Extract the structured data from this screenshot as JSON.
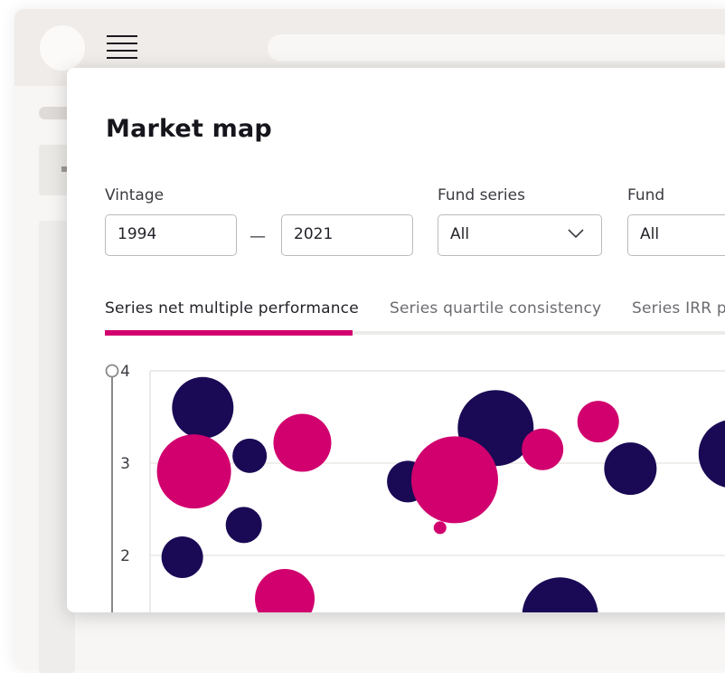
{
  "modal": {
    "title": "Market map",
    "filters": {
      "vintage_label": "Vintage",
      "vintage_from": "1994",
      "vintage_separator": "—",
      "vintage_to": "2021",
      "fund_series_label": "Fund series",
      "fund_series_value": "All",
      "fund_label": "Fund",
      "fund_value": "All"
    },
    "tabs": [
      {
        "label": "Series net multiple performance",
        "active": true
      },
      {
        "label": "Series quartile consistency",
        "active": false
      },
      {
        "label": "Series IRR pe",
        "active": false
      }
    ]
  },
  "colors": {
    "accent": "#d1006e",
    "navy": "#1a0a55",
    "tab_rule": "#ecebe9"
  },
  "icons": {
    "menu": "hamburger-menu-icon",
    "dropdown": "chevron-down-icon",
    "slider_handle": "circle-handle-icon"
  },
  "chart_data": {
    "type": "scatter",
    "y_ticks": [
      "4",
      "3",
      "2"
    ],
    "ylim": [
      1.4,
      4
    ],
    "xlim": [
      0,
      10
    ],
    "grid": true,
    "series": [
      {
        "color": "#1a0a55",
        "points": [
          {
            "x": 0.9,
            "y": 3.6,
            "r": 34
          },
          {
            "x": 1.7,
            "y": 3.08,
            "r": 19
          },
          {
            "x": 1.6,
            "y": 2.33,
            "r": 20
          },
          {
            "x": 0.55,
            "y": 1.98,
            "r": 23
          },
          {
            "x": 4.4,
            "y": 2.8,
            "r": 23
          },
          {
            "x": 5.9,
            "y": 3.38,
            "r": 42
          },
          {
            "x": 8.2,
            "y": 2.94,
            "r": 29
          },
          {
            "x": 7.0,
            "y": 1.35,
            "r": 42
          },
          {
            "x": 9.95,
            "y": 3.1,
            "r": 38
          }
        ]
      },
      {
        "color": "#d1006e",
        "points": [
          {
            "x": 0.75,
            "y": 2.91,
            "r": 41
          },
          {
            "x": 2.6,
            "y": 3.22,
            "r": 32
          },
          {
            "x": 5.2,
            "y": 2.82,
            "r": 48
          },
          {
            "x": 4.95,
            "y": 2.3,
            "r": 7
          },
          {
            "x": 6.7,
            "y": 3.15,
            "r": 23
          },
          {
            "x": 7.65,
            "y": 3.45,
            "r": 23
          },
          {
            "x": 2.3,
            "y": 1.53,
            "r": 33
          }
        ]
      }
    ]
  }
}
